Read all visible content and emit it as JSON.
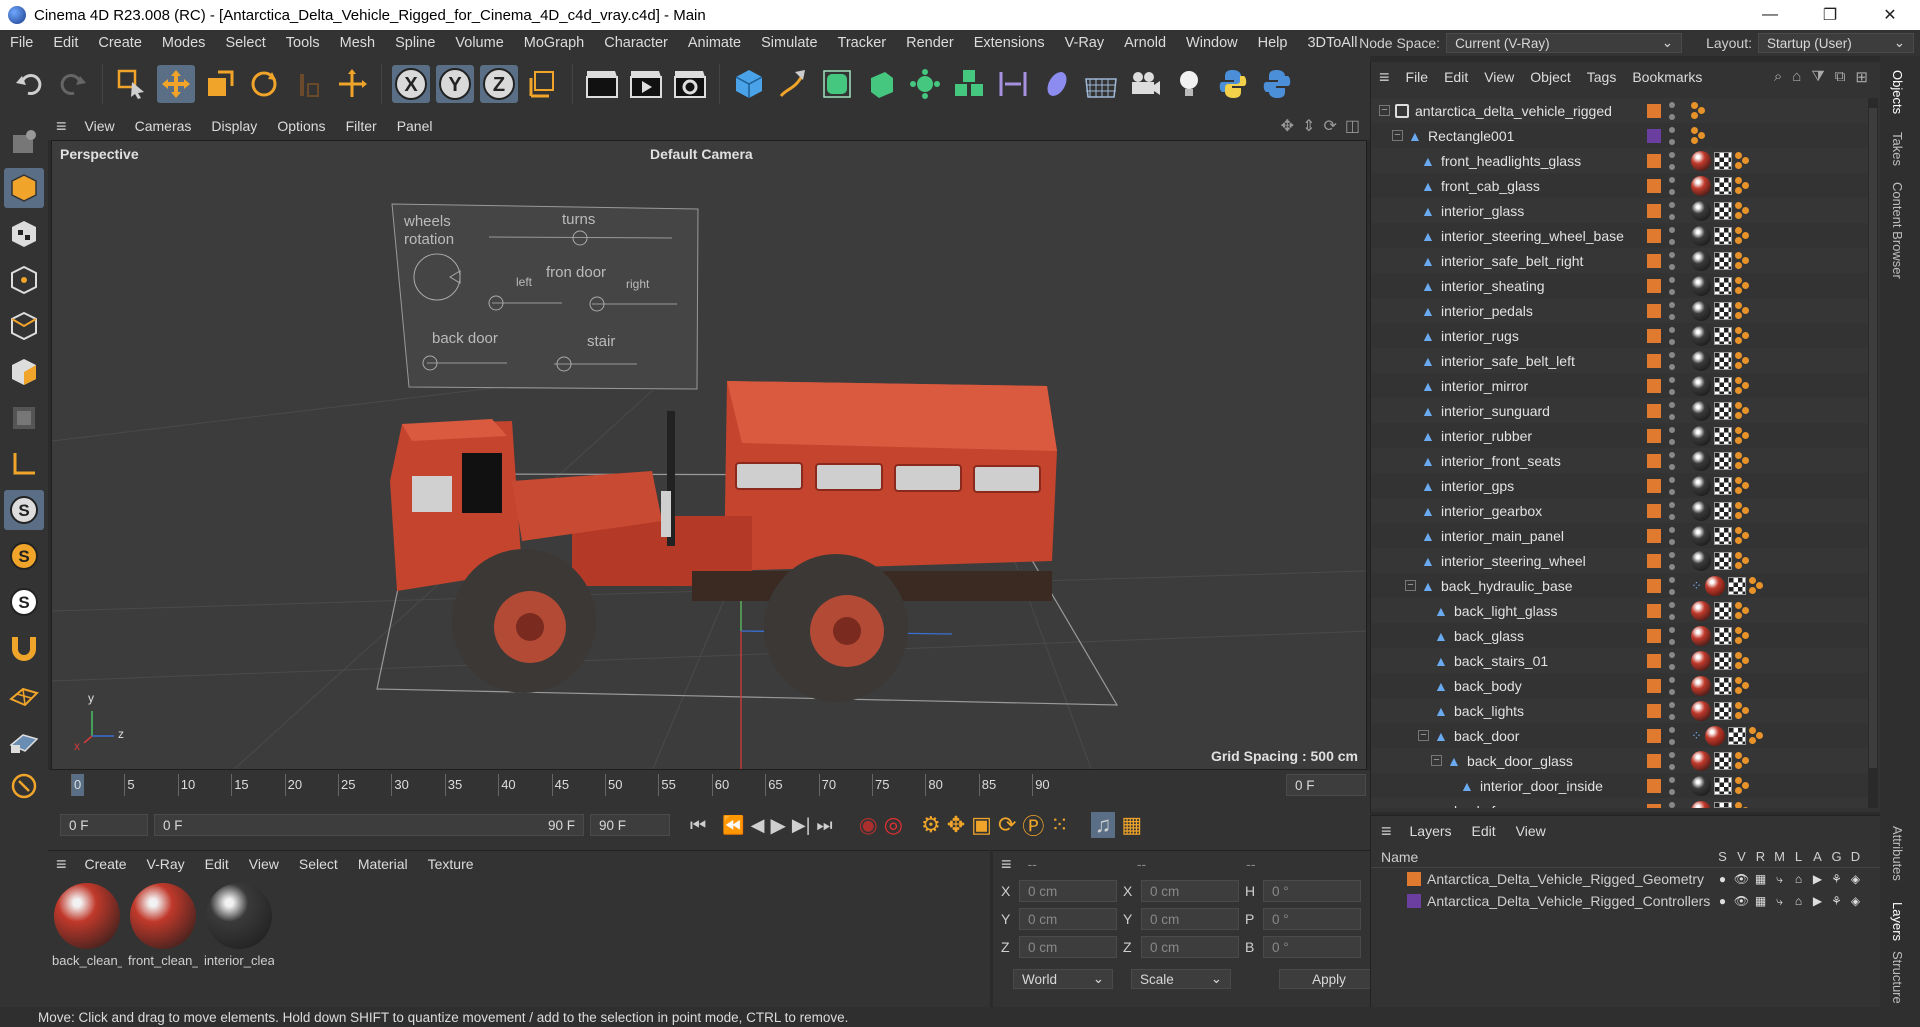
{
  "window": {
    "title": "Cinema 4D R23.008 (RC) - [Antarctica_Delta_Vehicle_Rigged_for_Cinema_4D_c4d_vray.c4d] - Main",
    "minimize": "—",
    "restore": "❐",
    "close": "✕"
  },
  "menubar": {
    "items": [
      "File",
      "Edit",
      "Create",
      "Modes",
      "Select",
      "Tools",
      "Mesh",
      "Spline",
      "Volume",
      "MoGraph",
      "Character",
      "Animate",
      "Simulate",
      "Tracker",
      "Render",
      "Extensions",
      "V-Ray",
      "Arnold",
      "Window",
      "Help",
      "3DToAll"
    ],
    "node_space_label": "Node Space:",
    "node_space_value": "Current (V-Ray)",
    "layout_label": "Layout:",
    "layout_value": "Startup (User)"
  },
  "viewport": {
    "menu": [
      "View",
      "Cameras",
      "Display",
      "Options",
      "Filter",
      "Panel"
    ],
    "name": "Perspective",
    "camera": "Default Camera",
    "grid_spacing": "Grid Spacing : 500 cm",
    "axis_y": "y",
    "axis_z": "z",
    "axis_x": "x",
    "hud": {
      "wheels": "wheels",
      "rotation": "rotation",
      "turns": "turns",
      "front_door": "fron  door",
      "left": "left",
      "right": "right",
      "back_door": "back door",
      "stair": "stair"
    }
  },
  "timeline": {
    "ticks": [
      "0",
      "5",
      "10",
      "15",
      "20",
      "25",
      "30",
      "35",
      "40",
      "45",
      "50",
      "55",
      "60",
      "65",
      "70",
      "75",
      "80",
      "85",
      "90"
    ],
    "end_field": "0 F"
  },
  "transport": {
    "current": "0 F",
    "range_start": "0 F",
    "range_end": "90 F",
    "max": "90 F"
  },
  "material_panel": {
    "menu": [
      "Create",
      "V-Ray",
      "Edit",
      "View",
      "Select",
      "Material",
      "Texture"
    ],
    "materials": [
      {
        "name": "back_clean_",
        "color": "#c0392b"
      },
      {
        "name": "front_clean_",
        "color": "#c0392b"
      },
      {
        "name": "interior_clea",
        "color": "#3a3a3a"
      }
    ]
  },
  "coords": {
    "headers": [
      "--",
      "--",
      "--"
    ],
    "rows": [
      {
        "a": "X",
        "av": "0 cm",
        "b": "X",
        "bv": "0 cm",
        "c": "H",
        "cv": "0 °"
      },
      {
        "a": "Y",
        "av": "0 cm",
        "b": "Y",
        "bv": "0 cm",
        "c": "P",
        "cv": "0 °"
      },
      {
        "a": "Z",
        "av": "0 cm",
        "b": "Z",
        "bv": "0 cm",
        "c": "B",
        "cv": "0 °"
      }
    ],
    "world": "World",
    "scale": "Scale",
    "apply": "Apply"
  },
  "objects_panel": {
    "menu": [
      "File",
      "Edit",
      "View",
      "Object",
      "Tags",
      "Bookmarks"
    ],
    "items": [
      {
        "name": "antarctica_delta_vehicle_rigged",
        "indent": 0,
        "icon": "null",
        "swatch": "#e07a2e",
        "tags": "dots"
      },
      {
        "name": "Rectangle001",
        "indent": 1,
        "icon": "spline",
        "swatch": "#6b3fa0",
        "tags": "dots"
      },
      {
        "name": "front_headlights_glass",
        "indent": 2,
        "icon": "poly",
        "swatch": "#e07a2e",
        "tags": "ball-red"
      },
      {
        "name": "front_cab_glass",
        "indent": 2,
        "icon": "poly",
        "swatch": "#e07a2e",
        "tags": "ball-red"
      },
      {
        "name": "interior_glass",
        "indent": 2,
        "icon": "poly",
        "swatch": "#e07a2e",
        "tags": "ball-dark"
      },
      {
        "name": "interior_steering_wheel_base",
        "indent": 2,
        "icon": "poly",
        "swatch": "#e07a2e",
        "tags": "ball-dark"
      },
      {
        "name": "interior_safe_belt_right",
        "indent": 2,
        "icon": "poly",
        "swatch": "#e07a2e",
        "tags": "ball-dark"
      },
      {
        "name": "interior_sheating",
        "indent": 2,
        "icon": "poly",
        "swatch": "#e07a2e",
        "tags": "ball-dark"
      },
      {
        "name": "interior_pedals",
        "indent": 2,
        "icon": "poly",
        "swatch": "#e07a2e",
        "tags": "ball-dark"
      },
      {
        "name": "interior_rugs",
        "indent": 2,
        "icon": "poly",
        "swatch": "#e07a2e",
        "tags": "ball-dark"
      },
      {
        "name": "interior_safe_belt_left",
        "indent": 2,
        "icon": "poly",
        "swatch": "#e07a2e",
        "tags": "ball-dark"
      },
      {
        "name": "interior_mirror",
        "indent": 2,
        "icon": "poly",
        "swatch": "#e07a2e",
        "tags": "ball-dark"
      },
      {
        "name": "interior_sunguard",
        "indent": 2,
        "icon": "poly",
        "swatch": "#e07a2e",
        "tags": "ball-dark"
      },
      {
        "name": "interior_rubber",
        "indent": 2,
        "icon": "poly",
        "swatch": "#e07a2e",
        "tags": "ball-dark"
      },
      {
        "name": "interior_front_seats",
        "indent": 2,
        "icon": "poly",
        "swatch": "#e07a2e",
        "tags": "ball-dark"
      },
      {
        "name": "interior_gps",
        "indent": 2,
        "icon": "poly",
        "swatch": "#e07a2e",
        "tags": "ball-dark"
      },
      {
        "name": "interior_gearbox",
        "indent": 2,
        "icon": "poly",
        "swatch": "#e07a2e",
        "tags": "ball-dark"
      },
      {
        "name": "interior_main_panel",
        "indent": 2,
        "icon": "poly",
        "swatch": "#e07a2e",
        "tags": "ball-dark"
      },
      {
        "name": "interior_steering_wheel",
        "indent": 2,
        "icon": "poly",
        "swatch": "#e07a2e",
        "tags": "ball-dark"
      },
      {
        "name": "back_hydraulic_base",
        "indent": 2,
        "icon": "poly",
        "swatch": "#e07a2e",
        "tags": "multi"
      },
      {
        "name": "back_light_glass",
        "indent": 3,
        "icon": "poly",
        "swatch": "#e07a2e",
        "tags": "ball-red"
      },
      {
        "name": "back_glass",
        "indent": 3,
        "icon": "poly",
        "swatch": "#e07a2e",
        "tags": "ball-red"
      },
      {
        "name": "back_stairs_01",
        "indent": 3,
        "icon": "poly",
        "swatch": "#e07a2e",
        "tags": "ball-red"
      },
      {
        "name": "back_body",
        "indent": 3,
        "icon": "poly",
        "swatch": "#e07a2e",
        "tags": "ball-red"
      },
      {
        "name": "back_lights",
        "indent": 3,
        "icon": "poly",
        "swatch": "#e07a2e",
        "tags": "ball-red"
      },
      {
        "name": "back_door",
        "indent": 3,
        "icon": "poly",
        "swatch": "#e07a2e",
        "tags": "multi"
      },
      {
        "name": "back_door_glass",
        "indent": 4,
        "icon": "poly",
        "swatch": "#e07a2e",
        "tags": "ball-red"
      },
      {
        "name": "interior_door_inside",
        "indent": 5,
        "icon": "poly",
        "swatch": "#e07a2e",
        "tags": "ball-dark"
      },
      {
        "name": "back_frame",
        "indent": 3,
        "icon": "poly",
        "swatch": "#e07a2e",
        "tags": "ball-red"
      }
    ]
  },
  "layers_panel": {
    "menu": [
      "Layers",
      "Edit",
      "View"
    ],
    "header_name": "Name",
    "cols": [
      "S",
      "V",
      "R",
      "M",
      "L",
      "A",
      "G",
      "D"
    ],
    "layers": [
      {
        "name": "Antarctica_Delta_Vehicle_Rigged_Geometry",
        "color": "#e07a2e"
      },
      {
        "name": "Antarctica_Delta_Vehicle_Rigged_Controllers",
        "color": "#6b3fa0"
      }
    ]
  },
  "right_tabs": [
    "Objects",
    "Takes",
    "Content Browser",
    "Attributes",
    "Layers",
    "Structure"
  ],
  "status": "Move: Click and drag to move elements. Hold down SHIFT to quantize movement / add to the selection in point mode, CTRL to remove."
}
